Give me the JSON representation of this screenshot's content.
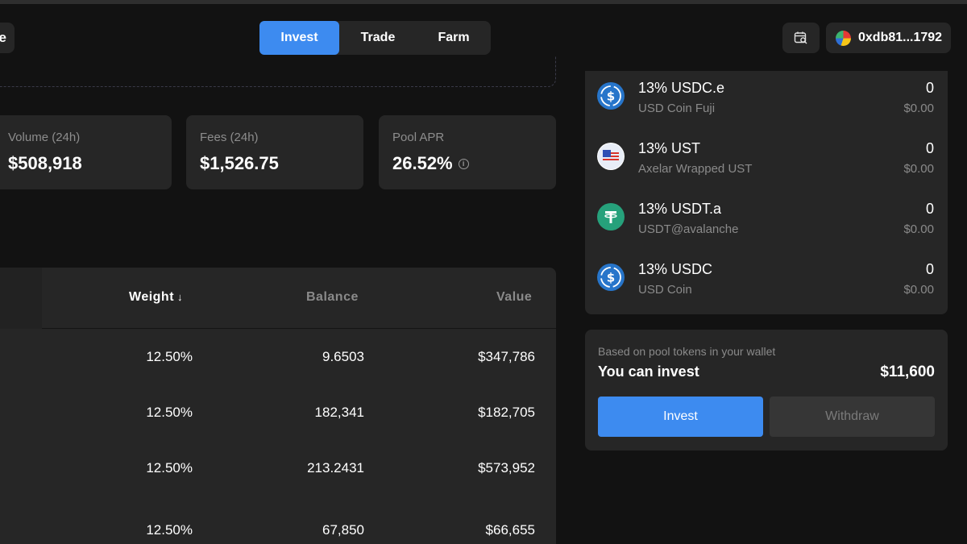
{
  "header": {
    "left_pill_text": "e",
    "nav": [
      {
        "label": "Invest",
        "active": true
      },
      {
        "label": "Trade",
        "active": false
      },
      {
        "label": "Farm",
        "active": false
      }
    ],
    "calendar_icon": "calendar-search-icon",
    "wallet_address": "0xdb81...1792"
  },
  "stats": {
    "volume": {
      "label": "Volume (24h)",
      "value": "$508,918"
    },
    "fees": {
      "label": "Fees (24h)",
      "value": "$1,526.75"
    },
    "apr": {
      "label": "Pool APR",
      "value": "26.52%",
      "info_icon": "info-icon"
    }
  },
  "table": {
    "headers": {
      "weight": "Weight",
      "weight_sort": "↓",
      "balance": "Balance",
      "value": "Value"
    },
    "rows": [
      {
        "weight": "12.50%",
        "balance": "9.6503",
        "value": "$347,786"
      },
      {
        "weight": "12.50%",
        "balance": "182,341",
        "value": "$182,705"
      },
      {
        "weight": "12.50%",
        "balance": "213.2431",
        "value": "$573,952"
      },
      {
        "weight": "12.50%",
        "balance": "67,850",
        "value": "$66,655"
      }
    ]
  },
  "tokens": [
    {
      "name": "13% USDC.e",
      "sub": "USD Coin Fuji",
      "amount": "0",
      "usd": "$0.00",
      "icon": "usdc-icon",
      "icon_color": "#2775ca"
    },
    {
      "name": "13% UST",
      "sub": "Axelar Wrapped UST",
      "amount": "0",
      "usd": "$0.00",
      "icon": "ust-icon",
      "icon_color": "#4a6fd8"
    },
    {
      "name": "13% USDT.a",
      "sub": "USDT@avalanche",
      "amount": "0",
      "usd": "$0.00",
      "icon": "tether-icon",
      "icon_color": "#26a17b"
    },
    {
      "name": "13% USDC",
      "sub": "USD Coin",
      "amount": "0",
      "usd": "$0.00",
      "icon": "usdc-icon",
      "icon_color": "#2775ca"
    }
  ],
  "invest_card": {
    "subtitle": "Based on pool tokens in your wallet",
    "title": "You can invest",
    "amount": "$11,600",
    "invest_label": "Invest",
    "withdraw_label": "Withdraw"
  },
  "colors": {
    "accent": "#3d8bf0",
    "background": "#121212",
    "card": "#262626"
  }
}
